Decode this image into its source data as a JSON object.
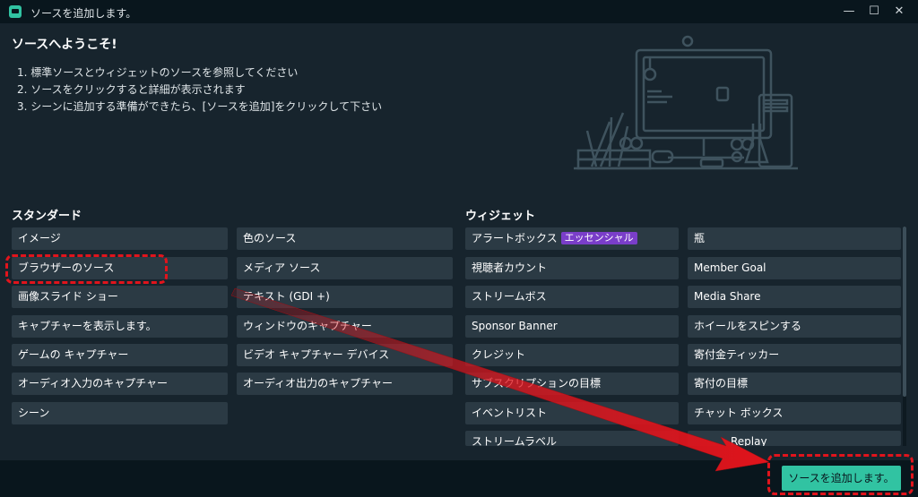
{
  "window": {
    "title": "ソースを追加します。",
    "controls": [
      "—",
      "☐",
      "✕"
    ]
  },
  "intro": {
    "heading": "ソースへようこそ!",
    "steps": [
      "1. 標準ソースとウィジェットのソースを参照してください",
      "2. ソースをクリックすると詳細が表示されます",
      "3. シーンに追加する準備ができたら、[ソースを追加]をクリックして下さい"
    ]
  },
  "standard": {
    "title": "スタンダード",
    "col1": [
      "イメージ",
      "ブラウザーのソース",
      "画像スライド ショー",
      "キャプチャーを表示します。",
      "ゲームの キャプチャー",
      "オーディオ入力のキャプチャー",
      "シーン"
    ],
    "col2": [
      "色のソース",
      "メディア ソース",
      "テキスト (GDI +)",
      "ウィンドウのキャプチャー",
      "ビデオ キャプチャー デバイス",
      "オーディオ出力のキャプチャー"
    ]
  },
  "widgets": {
    "title": "ウィジェット",
    "col1": [
      "アラートボックス",
      "視聴者カウント",
      "ストリームボス",
      "Sponsor Banner",
      "クレジット",
      "サブスクリプションの目標",
      "イベントリスト",
      "ストリームラベル"
    ],
    "col1_badge": "エッセンシャル",
    "col2": [
      "瓶",
      "Member Goal",
      "Media Share",
      "ホイールをスピンする",
      "寄付金ティッカー",
      "寄付の目標",
      "チャット ボックス",
      "Replay"
    ]
  },
  "footer": {
    "add_button": "ソースを追加します。"
  },
  "annotation": {
    "color": "#e1141c"
  }
}
